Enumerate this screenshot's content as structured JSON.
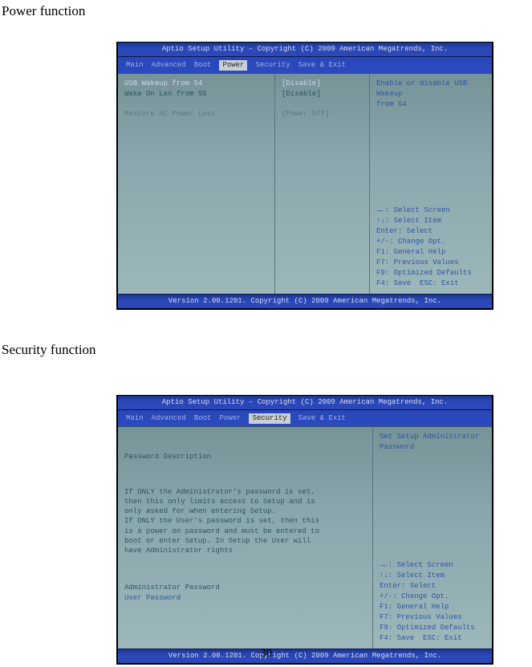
{
  "page_number": "30",
  "headings": {
    "power": "Power function",
    "security": "Security function"
  },
  "common": {
    "top_band": "Aptio Setup Utility – Copyright (C) 2009 American Megatrends, Inc.",
    "bottom_band": "Version 2.00.1201. Copyright (C) 2009 American Megatrends, Inc.",
    "menu": {
      "main": "Main",
      "advanced": "Advanced",
      "boot": "Boot",
      "power": "Power",
      "security": "Security",
      "save_exit": "Save & Exit"
    },
    "help_keys": {
      "l1": "→←: Select Screen",
      "l2": "↑↓: Select Item",
      "l3": "Enter: Select",
      "l4": "+/-: Change Opt.",
      "l5": "F1: General Help",
      "l6": "F7: Previous Values",
      "l7": "F9: Optimized Defaults",
      "l8": "F4: Save  ESC: Exit"
    }
  },
  "power_screen": {
    "selected_tab": "Power",
    "rows": {
      "r1_label": "USB Wakeup from S4",
      "r1_value": "[Disable]",
      "r2_label": "Wake On Lan from S5",
      "r2_value": "[Disable]",
      "r3_label": "Restore AC Power Loss",
      "r3_value": "[Power Off]"
    },
    "help_top": "Enable or disable USB Wakeup\nfrom S4"
  },
  "security_screen": {
    "selected_tab": "Security",
    "desc_head": "Password Description",
    "desc_body": "If ONLY the Administrator's password is set,\nthen this only limits access to Setup and is\nonly asked for when entering Setup.\nIf ONLY the User's password is set, then this\nis a power on password and must be entered to\nboot or enter Setup. In Setup the User will\nhave Administrator rights",
    "admin_label": "Administrator Password",
    "user_label": "User Password",
    "help_top": "Set Setup Administrator\nPassword"
  }
}
